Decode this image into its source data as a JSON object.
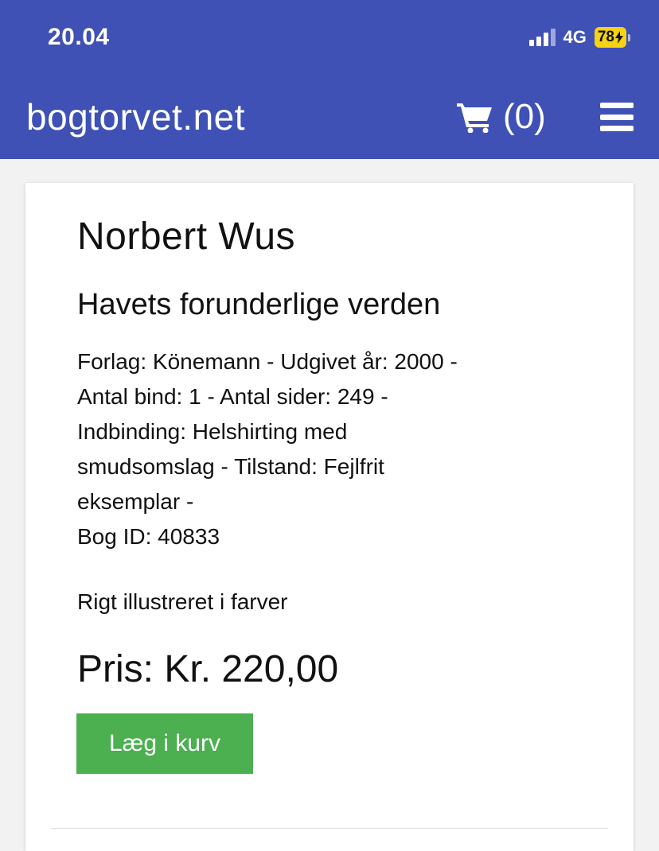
{
  "status_bar": {
    "time": "20.04",
    "network": "4G",
    "battery": "78"
  },
  "header": {
    "brand": "bogtorvet.net",
    "cart_count": "(0)",
    "icons": {
      "cart": "cart-icon",
      "menu": "hamburger-menu-icon"
    }
  },
  "book": {
    "author": "Norbert Wus",
    "title": "Havets forunderlige verden",
    "details": [
      "Forlag: Könemann - Udgivet år: 2000 -",
      "Antal bind: 1 - Antal sider: 249 -",
      "Indbinding: Helshirting med",
      "smudsomslag - Tilstand: Fejlfrit",
      "eksemplar -",
      "Bog ID: 40833"
    ],
    "note": "Rigt illustreret i farver",
    "price": "Pris: Kr. 220,00",
    "add_to_cart_label": "Læg i kurv"
  },
  "colors": {
    "header_bg": "#3f51b5",
    "button_bg": "#4caf50",
    "battery": "#f5d213"
  }
}
